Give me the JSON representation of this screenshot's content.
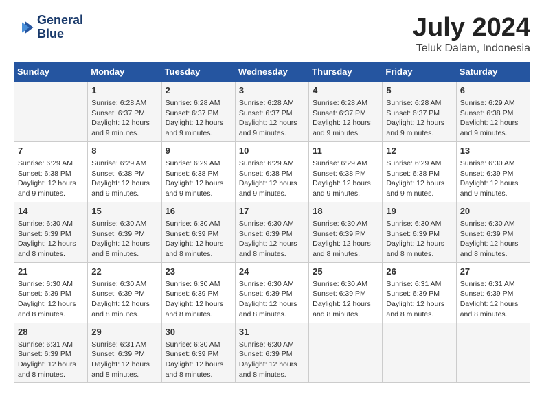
{
  "header": {
    "logo_line1": "General",
    "logo_line2": "Blue",
    "month_year": "July 2024",
    "location": "Teluk Dalam, Indonesia"
  },
  "days_of_week": [
    "Sunday",
    "Monday",
    "Tuesday",
    "Wednesday",
    "Thursday",
    "Friday",
    "Saturday"
  ],
  "weeks": [
    [
      {
        "day": "",
        "content": ""
      },
      {
        "day": "1",
        "content": "Sunrise: 6:28 AM\nSunset: 6:37 PM\nDaylight: 12 hours\nand 9 minutes."
      },
      {
        "day": "2",
        "content": "Sunrise: 6:28 AM\nSunset: 6:37 PM\nDaylight: 12 hours\nand 9 minutes."
      },
      {
        "day": "3",
        "content": "Sunrise: 6:28 AM\nSunset: 6:37 PM\nDaylight: 12 hours\nand 9 minutes."
      },
      {
        "day": "4",
        "content": "Sunrise: 6:28 AM\nSunset: 6:37 PM\nDaylight: 12 hours\nand 9 minutes."
      },
      {
        "day": "5",
        "content": "Sunrise: 6:28 AM\nSunset: 6:37 PM\nDaylight: 12 hours\nand 9 minutes."
      },
      {
        "day": "6",
        "content": "Sunrise: 6:29 AM\nSunset: 6:38 PM\nDaylight: 12 hours\nand 9 minutes."
      }
    ],
    [
      {
        "day": "7",
        "content": "Sunrise: 6:29 AM\nSunset: 6:38 PM\nDaylight: 12 hours\nand 9 minutes."
      },
      {
        "day": "8",
        "content": "Sunrise: 6:29 AM\nSunset: 6:38 PM\nDaylight: 12 hours\nand 9 minutes."
      },
      {
        "day": "9",
        "content": "Sunrise: 6:29 AM\nSunset: 6:38 PM\nDaylight: 12 hours\nand 9 minutes."
      },
      {
        "day": "10",
        "content": "Sunrise: 6:29 AM\nSunset: 6:38 PM\nDaylight: 12 hours\nand 9 minutes."
      },
      {
        "day": "11",
        "content": "Sunrise: 6:29 AM\nSunset: 6:38 PM\nDaylight: 12 hours\nand 9 minutes."
      },
      {
        "day": "12",
        "content": "Sunrise: 6:29 AM\nSunset: 6:38 PM\nDaylight: 12 hours\nand 9 minutes."
      },
      {
        "day": "13",
        "content": "Sunrise: 6:30 AM\nSunset: 6:39 PM\nDaylight: 12 hours\nand 9 minutes."
      }
    ],
    [
      {
        "day": "14",
        "content": "Sunrise: 6:30 AM\nSunset: 6:39 PM\nDaylight: 12 hours\nand 8 minutes."
      },
      {
        "day": "15",
        "content": "Sunrise: 6:30 AM\nSunset: 6:39 PM\nDaylight: 12 hours\nand 8 minutes."
      },
      {
        "day": "16",
        "content": "Sunrise: 6:30 AM\nSunset: 6:39 PM\nDaylight: 12 hours\nand 8 minutes."
      },
      {
        "day": "17",
        "content": "Sunrise: 6:30 AM\nSunset: 6:39 PM\nDaylight: 12 hours\nand 8 minutes."
      },
      {
        "day": "18",
        "content": "Sunrise: 6:30 AM\nSunset: 6:39 PM\nDaylight: 12 hours\nand 8 minutes."
      },
      {
        "day": "19",
        "content": "Sunrise: 6:30 AM\nSunset: 6:39 PM\nDaylight: 12 hours\nand 8 minutes."
      },
      {
        "day": "20",
        "content": "Sunrise: 6:30 AM\nSunset: 6:39 PM\nDaylight: 12 hours\nand 8 minutes."
      }
    ],
    [
      {
        "day": "21",
        "content": "Sunrise: 6:30 AM\nSunset: 6:39 PM\nDaylight: 12 hours\nand 8 minutes."
      },
      {
        "day": "22",
        "content": "Sunrise: 6:30 AM\nSunset: 6:39 PM\nDaylight: 12 hours\nand 8 minutes."
      },
      {
        "day": "23",
        "content": "Sunrise: 6:30 AM\nSunset: 6:39 PM\nDaylight: 12 hours\nand 8 minutes."
      },
      {
        "day": "24",
        "content": "Sunrise: 6:30 AM\nSunset: 6:39 PM\nDaylight: 12 hours\nand 8 minutes."
      },
      {
        "day": "25",
        "content": "Sunrise: 6:30 AM\nSunset: 6:39 PM\nDaylight: 12 hours\nand 8 minutes."
      },
      {
        "day": "26",
        "content": "Sunrise: 6:31 AM\nSunset: 6:39 PM\nDaylight: 12 hours\nand 8 minutes."
      },
      {
        "day": "27",
        "content": "Sunrise: 6:31 AM\nSunset: 6:39 PM\nDaylight: 12 hours\nand 8 minutes."
      }
    ],
    [
      {
        "day": "28",
        "content": "Sunrise: 6:31 AM\nSunset: 6:39 PM\nDaylight: 12 hours\nand 8 minutes."
      },
      {
        "day": "29",
        "content": "Sunrise: 6:31 AM\nSunset: 6:39 PM\nDaylight: 12 hours\nand 8 minutes."
      },
      {
        "day": "30",
        "content": "Sunrise: 6:30 AM\nSunset: 6:39 PM\nDaylight: 12 hours\nand 8 minutes."
      },
      {
        "day": "31",
        "content": "Sunrise: 6:30 AM\nSunset: 6:39 PM\nDaylight: 12 hours\nand 8 minutes."
      },
      {
        "day": "",
        "content": ""
      },
      {
        "day": "",
        "content": ""
      },
      {
        "day": "",
        "content": ""
      }
    ]
  ]
}
